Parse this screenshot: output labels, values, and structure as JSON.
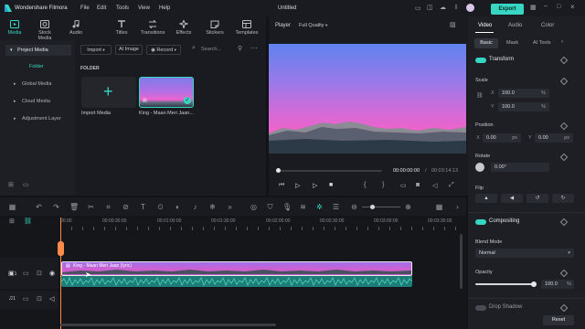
{
  "app": {
    "name": "Wondershare Filmora",
    "menu": [
      "File",
      "Edit",
      "Tools",
      "View",
      "Help"
    ],
    "project_title": "Untitled",
    "export_label": "Export"
  },
  "toolbar": {
    "items": [
      {
        "label": "Media",
        "icon": "media-icon",
        "active": true
      },
      {
        "label": "Stock Media",
        "icon": "stock-media-icon"
      },
      {
        "label": "Audio",
        "icon": "audio-note-icon"
      },
      {
        "label": "Titles",
        "icon": "titles-icon"
      },
      {
        "label": "Transitions",
        "icon": "transitions-icon"
      },
      {
        "label": "Effects",
        "icon": "effects-icon"
      },
      {
        "label": "Stickers",
        "icon": "stickers-icon"
      },
      {
        "label": "Templates",
        "icon": "templates-icon"
      }
    ]
  },
  "library": {
    "nav": [
      {
        "label": "Project Media",
        "selected": true
      },
      {
        "label": "Folder",
        "selected": false
      },
      {
        "label": "Global Media",
        "selected": false
      },
      {
        "label": "Cloud Media",
        "selected": false
      },
      {
        "label": "Adjustment Layer",
        "selected": false
      }
    ],
    "import_label": "Import",
    "ai_image_label": "AI Image",
    "record_label": "Record",
    "search_placeholder": "Search...",
    "folder_heading": "FOLDER",
    "import_media_label": "Import Media",
    "media_item_name": "King - Maan Meri Jaan..."
  },
  "player": {
    "label": "Player",
    "quality": "Full Quality",
    "current_time": "00:00:00:00",
    "total_time": "00:03:14:13"
  },
  "inspector": {
    "tabs": [
      "Video",
      "Audio",
      "Color"
    ],
    "subtabs": [
      "Basic",
      "Mask",
      "AI Tools"
    ],
    "transform_label": "Transform",
    "scale_label": "Scale",
    "scale_x": "100.0",
    "scale_y": "100.0",
    "scale_unit": "%",
    "position_label": "Position",
    "pos_x": "0.00",
    "pos_y": "0.00",
    "pos_unit": "px",
    "rotate_label": "Rotate",
    "rotate_value": "0.00°",
    "flip_label": "Flip",
    "compositing_label": "Compositing",
    "blend_mode_label": "Blend Mode",
    "blend_mode_value": "Normal",
    "opacity_label": "Opacity",
    "opacity_value": "100.0",
    "opacity_unit": "%",
    "opacity_level": 1.0,
    "drop_shadow_label": "Drop Shadow",
    "reset_label": "Reset"
  },
  "timeline": {
    "ruler": [
      "00:00",
      "00:00:30:00",
      "00:01:00:00",
      "00:01:30:00",
      "00:02:00:00",
      "00:02:30:00",
      "00:03:00:00",
      "00:03:30:00"
    ],
    "clip_label": "King - Maan Meri Jaan (lyric)",
    "video_track_num": "1",
    "audio_track_num": "1"
  },
  "colors": {
    "accent": "#36d6c2",
    "clip_purple": "#b36ae0",
    "audio_teal": "#1d7e78"
  }
}
